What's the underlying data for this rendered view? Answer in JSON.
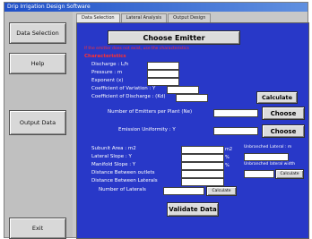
{
  "window": {
    "title": "Drip Irrigation Design Software"
  },
  "sidebar": {
    "buttons": [
      {
        "label": "Data Selection"
      },
      {
        "label": "Help"
      },
      {
        "label": "Output Data"
      },
      {
        "label": "Exit"
      }
    ]
  },
  "tabs": [
    {
      "label": "Data Selection",
      "active": true
    },
    {
      "label": "Lateral Analysis"
    },
    {
      "label": "Output Design"
    }
  ],
  "panel": {
    "choose_emitter": "Choose Emitter",
    "hint": "If the emitter does not exist, use the characteristics",
    "characteristics_label": "Characteristics",
    "discharge_label": "Discharge : L/h",
    "pressure_label": "Pressure : m",
    "exponent_label": "Exponent (x)",
    "coef_variation_label": "Coefficient of Variation : Y",
    "coef_discharge_label": "Coefficient of Discharge : (Kd)",
    "calculate_label": "Calculate",
    "emitters_per_plant_label": "Number of Emitters per Plant (Ne)",
    "choose_label": "Choose",
    "emission_uniformity_label": "Emission Uniformity : Y",
    "choose2_label": "Choose",
    "subunit_area_label": "Subunit Area : m2",
    "lateral_slope_label": "Lateral Slope : Y",
    "manifold_slope_label": "Manifold Slope : Y",
    "dist_outlets_label": "Distance Between outlets",
    "dist_laterals_label": "Distance Between Laterals",
    "num_laterals_label": "Number of Laterals",
    "calc_small_label": "Calculate",
    "unit_m2": "m2",
    "unit_pct": "%",
    "subunit_length_label": "Unbranched Lateral : m",
    "subunit_width_label": "Unbranched lateral width",
    "calc_small2_label": "Calculate",
    "validate_label": "Validate Data"
  }
}
